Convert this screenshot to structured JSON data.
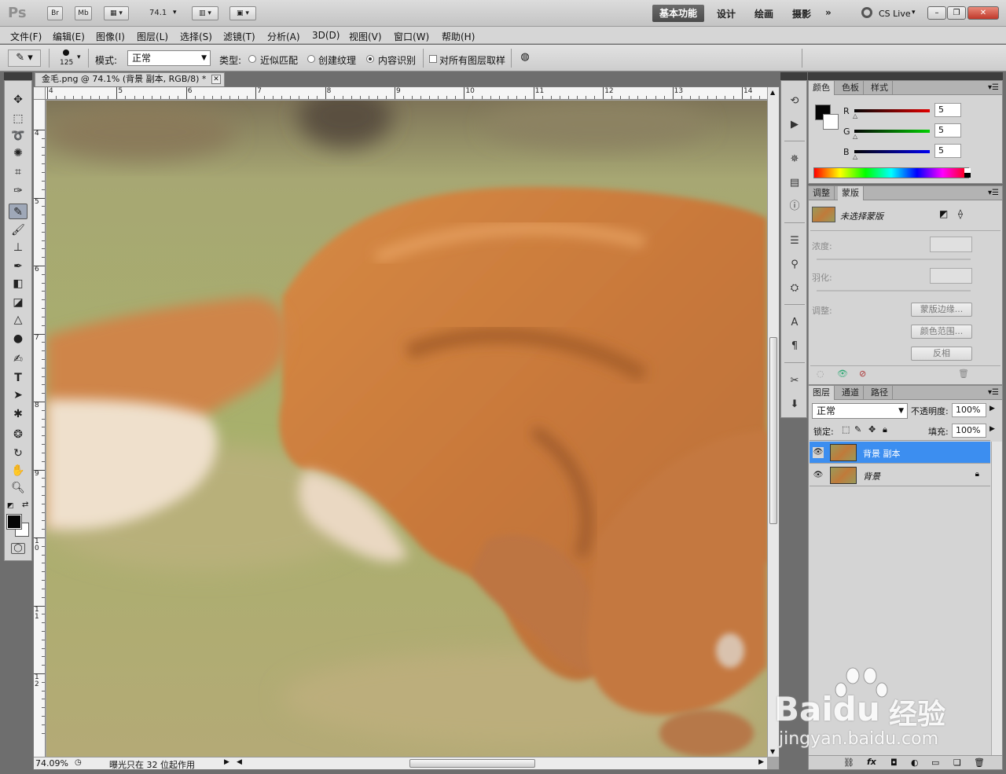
{
  "appbar": {
    "logo": "Ps",
    "br": "Br",
    "mb": "Mb",
    "zoom": "74.1",
    "workspaces": [
      "基本功能",
      "设计",
      "绘画",
      "摄影"
    ],
    "more": "»",
    "cs_live": "CS Live"
  },
  "menu": [
    "文件(F)",
    "编辑(E)",
    "图像(I)",
    "图层(L)",
    "选择(S)",
    "滤镜(T)",
    "分析(A)",
    "3D(D)",
    "视图(V)",
    "窗口(W)",
    "帮助(H)"
  ],
  "options": {
    "brush_size": "125",
    "mode_label": "模式:",
    "mode_value": "正常",
    "type_label": "类型:",
    "radio_options": [
      "近似匹配",
      "创建纹理",
      "内容识别"
    ],
    "selected_radio": "内容识别",
    "sample_all_layers": "对所有图层取样"
  },
  "document": {
    "tab_title": "金毛.png @ 74.1% (背景 副本, RGB/8) *",
    "ruler_top": [
      "4",
      "5",
      "6",
      "7",
      "8",
      "9",
      "10",
      "11",
      "12",
      "13",
      "14"
    ],
    "ruler_left": [
      "4",
      "5",
      "6",
      "7",
      "8",
      "9",
      "10",
      "11",
      "12"
    ],
    "zoom_status": "74.09%",
    "status_text": "曝光只在 32 位起作用"
  },
  "color_panel": {
    "tabs": [
      "颜色",
      "色板",
      "样式"
    ],
    "channels": [
      {
        "label": "R",
        "value": "5",
        "color": "#d00000"
      },
      {
        "label": "G",
        "value": "5",
        "color": "#00c000"
      },
      {
        "label": "B",
        "value": "5",
        "color": "#0000e0"
      }
    ]
  },
  "masks_panel": {
    "tabs": [
      "调整",
      "蒙版"
    ],
    "mask_state": "未选择蒙版",
    "density_label": "浓度:",
    "feather_label": "羽化:",
    "refine_label": "调整:",
    "buttons": [
      "蒙版边缘...",
      "颜色范围...",
      "反相"
    ]
  },
  "layers_panel": {
    "tabs": [
      "图层",
      "通道",
      "路径"
    ],
    "blend_mode": "正常",
    "opacity_label": "不透明度:",
    "opacity_value": "100%",
    "lock_label": "锁定:",
    "fill_label": "填充:",
    "fill_value": "100%",
    "layers": [
      {
        "name": "背景 副本",
        "selected": true
      },
      {
        "name": "背景",
        "selected": false
      }
    ]
  },
  "watermark": {
    "brand": "Bai",
    "brand2": "du",
    "brand_cn": "经验",
    "url": "jingyan.baidu.com"
  }
}
